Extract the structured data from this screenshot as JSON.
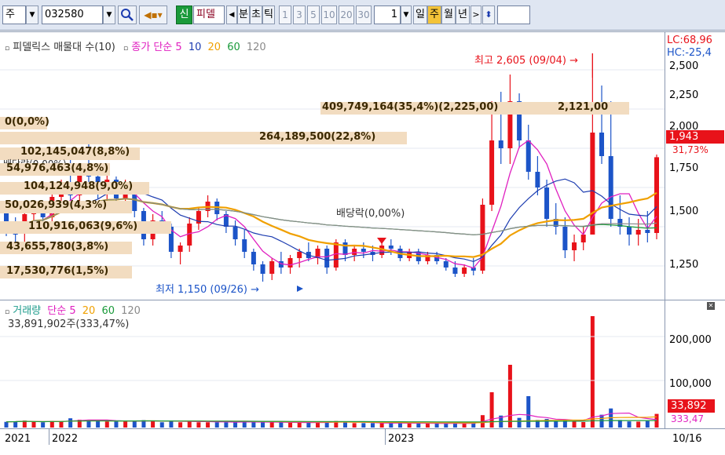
{
  "toolbar": {
    "market": "주",
    "code": "032580",
    "new_badge": "신",
    "stock_name": "피델",
    "periods_main": [
      "분",
      "초",
      "틱"
    ],
    "periods_num": [
      "1",
      "3",
      "5",
      "10",
      "20",
      "30"
    ],
    "count": "1",
    "periods_cal": [
      "일",
      "주",
      "월",
      "년"
    ],
    "selected_period": "주"
  },
  "price_panel": {
    "legend_title": "피델릭스 매물대 수(10)",
    "legend_close": "종가 단순 5",
    "ma_10": "10",
    "ma_20": "20",
    "ma_60": "60",
    "ma_120": "120",
    "lc": "LC:68,96",
    "hc": "HC:-25,4",
    "high_label": "최고 2,605 (09/04) →",
    "low_label": "최저 1,150 (09/26) →",
    "dividend_label": "배당락(0,00%)",
    "dividend_label_left": "배당락(0,00%)",
    "current_price": "1,943",
    "current_change": "31,73%",
    "volume_profile": [
      "409,749,164(35,4%)(2,225,00)",
      "2,121,00",
      "0(0,0%)",
      "264,189,500(22,8%)",
      "102,145,047(8,8%)",
      "54,976,463(4,8%)",
      "104,124,948(9,0%)",
      "50,026,939(4,3%)",
      "110,916,063(9,6%)",
      "43,655,780(3,8%)",
      "17,530,776(1,5%)"
    ],
    "y_ticks": [
      "2,500",
      "2,250",
      "2,000",
      "1,750",
      "1,500",
      "1,250"
    ]
  },
  "volume_panel": {
    "legend_title": "거래량",
    "legend_ma": "단순 5",
    "ma_20": "20",
    "ma_60": "60",
    "ma_120": "120",
    "current_volume": "33,891,902주(333,47%)",
    "last_volume_box": "33,892",
    "last_ratio": "333,47",
    "y_ticks": [
      "200,000",
      "100,000"
    ]
  },
  "x_axis": {
    "labels": [
      "2021",
      "2022",
      "2023"
    ],
    "right_label": "10/16"
  },
  "colors": {
    "up": "#e8121a",
    "down": "#1c54c8",
    "ma5": "#e020c0",
    "ma10": "#1c3cb0",
    "ma20": "#f0a000",
    "ma60": "#1a9a3a",
    "ma120": "#8a8a8a",
    "profile": "#f2dcc0"
  },
  "chart_data": {
    "type": "candlestick",
    "weekly_candles_approx": [
      [
        1600,
        1600,
        1440,
        1500
      ],
      [
        1500,
        1560,
        1380,
        1450
      ],
      [
        1460,
        1620,
        1400,
        1580
      ],
      [
        1580,
        1650,
        1500,
        1620
      ],
      [
        1620,
        1640,
        1500,
        1560
      ],
      [
        1560,
        1720,
        1520,
        1690
      ],
      [
        1690,
        1800,
        1620,
        1760
      ],
      [
        1760,
        1980,
        1650,
        1700
      ],
      [
        1700,
        1900,
        1640,
        1860
      ],
      [
        1860,
        2040,
        1780,
        1820
      ],
      [
        1820,
        1880,
        1680,
        1720
      ],
      [
        1720,
        1840,
        1660,
        1800
      ],
      [
        1800,
        1820,
        1640,
        1680
      ],
      [
        1680,
        1800,
        1620,
        1760
      ],
      [
        1760,
        1780,
        1560,
        1600
      ],
      [
        1600,
        1620,
        1380,
        1420
      ],
      [
        1420,
        1580,
        1380,
        1540
      ],
      [
        1540,
        1600,
        1460,
        1500
      ],
      [
        1500,
        1520,
        1300,
        1340
      ],
      [
        1340,
        1400,
        1260,
        1380
      ],
      [
        1380,
        1560,
        1340,
        1520
      ],
      [
        1520,
        1620,
        1480,
        1600
      ],
      [
        1600,
        1700,
        1560,
        1660
      ],
      [
        1660,
        1680,
        1540,
        1580
      ],
      [
        1580,
        1600,
        1460,
        1500
      ],
      [
        1500,
        1540,
        1380,
        1420
      ],
      [
        1420,
        1480,
        1300,
        1340
      ],
      [
        1340,
        1360,
        1220,
        1260
      ],
      [
        1260,
        1280,
        1150,
        1200
      ],
      [
        1200,
        1300,
        1160,
        1280
      ],
      [
        1280,
        1340,
        1200,
        1240
      ],
      [
        1240,
        1320,
        1200,
        1300
      ],
      [
        1300,
        1360,
        1240,
        1340
      ],
      [
        1340,
        1400,
        1280,
        1300
      ],
      [
        1300,
        1380,
        1260,
        1360
      ],
      [
        1360,
        1380,
        1200,
        1240
      ],
      [
        1240,
        1420,
        1220,
        1400
      ],
      [
        1400,
        1420,
        1280,
        1320
      ],
      [
        1320,
        1380,
        1280,
        1360
      ],
      [
        1360,
        1400,
        1300,
        1340
      ],
      [
        1340,
        1380,
        1280,
        1320
      ],
      [
        1320,
        1400,
        1300,
        1380
      ],
      [
        1380,
        1420,
        1320,
        1360
      ],
      [
        1360,
        1380,
        1280,
        1300
      ],
      [
        1300,
        1360,
        1280,
        1340
      ],
      [
        1340,
        1360,
        1260,
        1280
      ],
      [
        1280,
        1340,
        1260,
        1320
      ],
      [
        1320,
        1340,
        1260,
        1280
      ],
      [
        1280,
        1300,
        1220,
        1240
      ],
      [
        1240,
        1280,
        1180,
        1200
      ],
      [
        1200,
        1260,
        1180,
        1240
      ],
      [
        1240,
        1300,
        1190,
        1220
      ],
      [
        1220,
        1680,
        1200,
        1640
      ],
      [
        1640,
        2300,
        1600,
        2050
      ],
      [
        2050,
        2360,
        1900,
        2000
      ],
      [
        2000,
        2470,
        1900,
        2300
      ],
      [
        2300,
        2350,
        2000,
        2050
      ],
      [
        2050,
        2150,
        1800,
        1850
      ],
      [
        1850,
        1950,
        1700,
        1750
      ],
      [
        1750,
        1800,
        1500,
        1550
      ],
      [
        1550,
        1650,
        1450,
        1500
      ],
      [
        1500,
        1560,
        1300,
        1350
      ],
      [
        1350,
        1450,
        1280,
        1400
      ],
      [
        1400,
        1500,
        1350,
        1450
      ],
      [
        1450,
        2605,
        1450,
        2100
      ],
      [
        2100,
        2400,
        1900,
        1950
      ],
      [
        1950,
        2300,
        1500,
        1550
      ],
      [
        1550,
        1700,
        1450,
        1500
      ],
      [
        1500,
        1560,
        1380,
        1450
      ],
      [
        1450,
        1550,
        1380,
        1480
      ],
      [
        1480,
        1600,
        1400,
        1460
      ],
      [
        1460,
        1960,
        1420,
        1943
      ]
    ]
  }
}
